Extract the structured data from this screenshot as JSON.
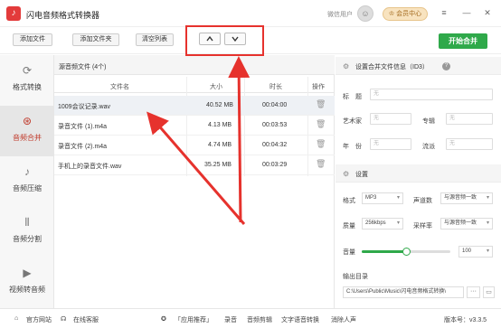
{
  "app": {
    "title": "闪电音频格式转换器",
    "logo": "music-note",
    "wechat_user": "微信用户",
    "vip_label": "会员中心"
  },
  "toolbar": {
    "add_file": "添加文件",
    "add_folder": "添加文件夹",
    "clear_list": "清空列表",
    "move_up_icon": "chevron-up-icon",
    "move_down_icon": "chevron-down-icon",
    "start_merge": "开始合并"
  },
  "sidebar": {
    "items": [
      {
        "label": "格式转换",
        "icon": "refresh-icon",
        "glyph": "⟳"
      },
      {
        "label": "音频合并",
        "icon": "merge-icon",
        "glyph": "⊛"
      },
      {
        "label": "音频压缩",
        "icon": "music-note-icon",
        "glyph": "♪"
      },
      {
        "label": "音频分割",
        "icon": "split-icon",
        "glyph": "⫴"
      },
      {
        "label": "视频转音频",
        "icon": "play-icon",
        "glyph": "▶"
      }
    ]
  },
  "filelist": {
    "title": "源音频文件 (4个)",
    "headers": {
      "name": "文件名",
      "size": "大小",
      "duration": "时长",
      "action": "操作"
    },
    "rows": [
      {
        "name": "1009会议记录.wav",
        "size": "40.52 MB",
        "duration": "00:04:00"
      },
      {
        "name": "录音文件 (1).m4a",
        "size": "4.13 MB",
        "duration": "00:03:53"
      },
      {
        "name": "录音文件 (2).m4a",
        "size": "4.74 MB",
        "duration": "00:04:32"
      },
      {
        "name": "手机上的录音文件.wav",
        "size": "35.25 MB",
        "duration": "00:03:29"
      }
    ]
  },
  "id3": {
    "title": "设置合并文件信息（ID3）",
    "fields": {
      "title_label": "标　题",
      "artist_label": "艺术家",
      "album_label": "专辑",
      "year_label": "年　份",
      "genre_label": "流派",
      "placeholder": "无"
    }
  },
  "settings": {
    "title": "设置",
    "format_label": "格式",
    "format_value": "MP3",
    "channels_label": "声道数",
    "channels_value": "与源音频一致",
    "quality_label": "质量",
    "quality_value": "256kbps",
    "samplerate_label": "采样率",
    "samplerate_value": "与源音频一致",
    "volume_label": "音量",
    "volume_value": "100",
    "volume_fraction": 0.5,
    "output_label": "输出目录",
    "output_path": "C:\\Users\\Public\\Music\\闪电音频格式转换\\",
    "browse": "···"
  },
  "footer": {
    "website": "官方网站",
    "support": "在线客服",
    "recommend": "「应用推荐」",
    "links": [
      "录音",
      "音频剪辑",
      "文字语音转换",
      "消除人声"
    ],
    "version": "版本号：v3.3.5"
  }
}
